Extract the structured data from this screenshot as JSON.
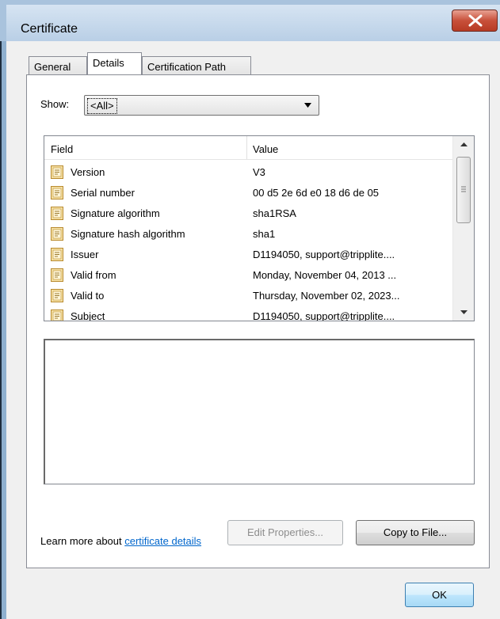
{
  "window": {
    "title": "Certificate",
    "close_label": "x"
  },
  "tabs": [
    {
      "label": "General",
      "active": false
    },
    {
      "label": "Details",
      "active": true
    },
    {
      "label": "Certification Path",
      "active": false
    }
  ],
  "show": {
    "label": "Show:",
    "selected": "<All>"
  },
  "list": {
    "columns": [
      "Field",
      "Value"
    ],
    "rows": [
      {
        "field": "Version",
        "value": "V3"
      },
      {
        "field": "Serial number",
        "value": "00 d5 2e 6d e0 18 d6 de 05"
      },
      {
        "field": "Signature algorithm",
        "value": "sha1RSA"
      },
      {
        "field": "Signature hash algorithm",
        "value": "sha1"
      },
      {
        "field": "Issuer",
        "value": "D1194050, support@tripplite...."
      },
      {
        "field": "Valid from",
        "value": "Monday, November 04, 2013 ..."
      },
      {
        "field": "Valid to",
        "value": "Thursday, November 02, 2023..."
      },
      {
        "field": "Subject",
        "value": "D1194050, support@tripplite...."
      }
    ]
  },
  "buttons": {
    "edit_properties": "Edit Properties...",
    "copy_to_file": "Copy to File...",
    "ok": "OK"
  },
  "learn_more": {
    "prefix": "Learn more about ",
    "link": "certificate details"
  },
  "colors": {
    "link": "#0066cc",
    "close_button": "#c8503a",
    "title_bar": "#b9cfe6",
    "dialog_bg": "#f0f0f0"
  }
}
